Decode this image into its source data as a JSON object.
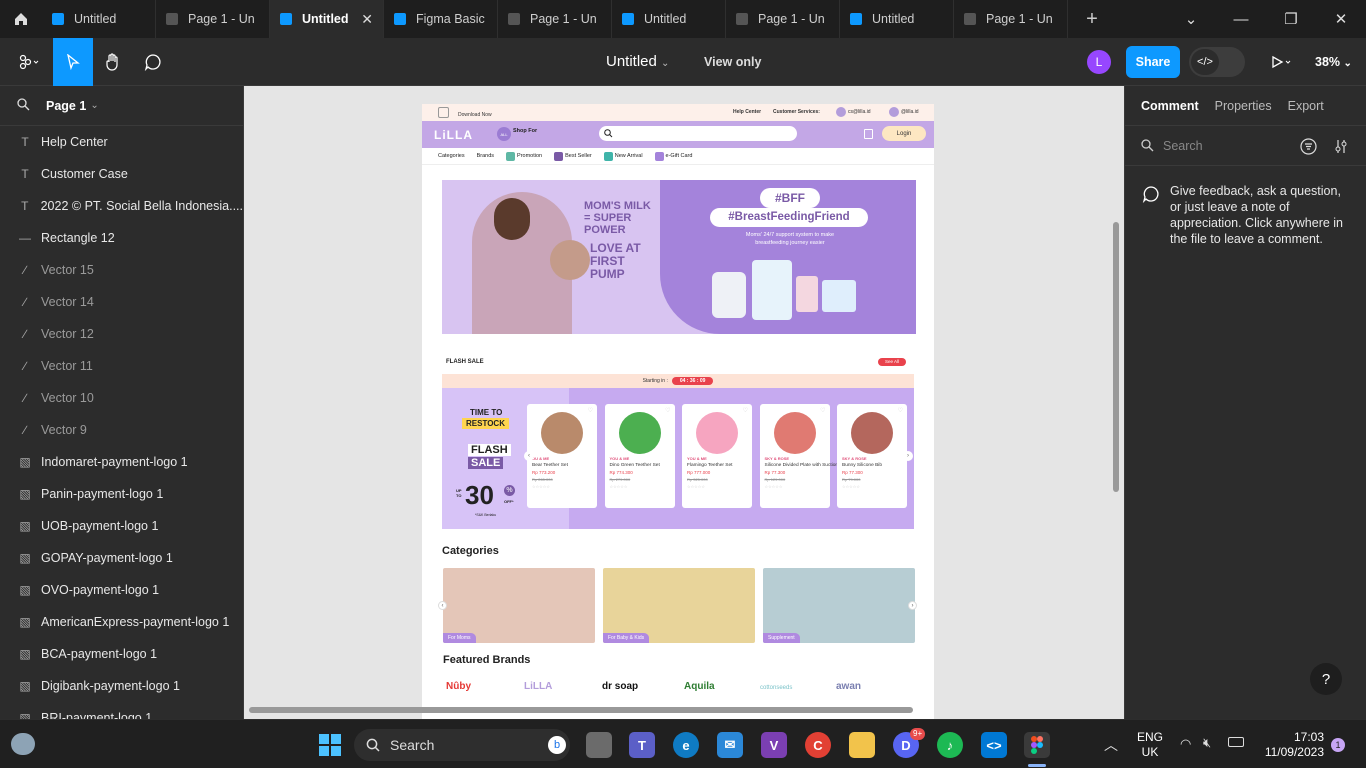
{
  "tabs": [
    {
      "label": "Untitled",
      "active": false
    },
    {
      "label": "Page 1 - Un",
      "active": false
    },
    {
      "label": "Untitled",
      "active": true
    },
    {
      "label": "Figma Basic",
      "active": false
    },
    {
      "label": "Page 1 - Un",
      "active": false
    },
    {
      "label": "Untitled",
      "active": false
    },
    {
      "label": "Page 1 - Un",
      "active": false
    },
    {
      "label": "Untitled",
      "active": false
    },
    {
      "label": "Page 1 - Un",
      "active": false
    }
  ],
  "toolbar": {
    "doc_title": "Untitled",
    "view_only": "View only",
    "avatar_initial": "L",
    "share": "Share",
    "zoom": "38%"
  },
  "left_panel": {
    "page": "Page 1",
    "layers": [
      {
        "label": "Help Center",
        "icon": "text-icon",
        "dim": false
      },
      {
        "label": "Customer Case",
        "icon": "text-icon",
        "dim": false
      },
      {
        "label": "2022 © PT. Social Bella Indonesia....",
        "icon": "text-icon",
        "dim": false
      },
      {
        "label": "Rectangle 12",
        "icon": "line-icon",
        "dim": false
      },
      {
        "label": "Vector 15",
        "icon": "vector-icon",
        "dim": true
      },
      {
        "label": "Vector 14",
        "icon": "vector-icon",
        "dim": true
      },
      {
        "label": "Vector 12",
        "icon": "vector-icon",
        "dim": true
      },
      {
        "label": "Vector 11",
        "icon": "vector-icon",
        "dim": true
      },
      {
        "label": "Vector 10",
        "icon": "vector-icon",
        "dim": true
      },
      {
        "label": "Vector 9",
        "icon": "vector-icon",
        "dim": true
      },
      {
        "label": "Indomaret-payment-logo 1",
        "icon": "image-icon",
        "dim": false
      },
      {
        "label": "Panin-payment-logo 1",
        "icon": "image-icon",
        "dim": false
      },
      {
        "label": "UOB-payment-logo 1",
        "icon": "image-icon",
        "dim": false
      },
      {
        "label": "GOPAY-payment-logo 1",
        "icon": "image-icon",
        "dim": false
      },
      {
        "label": "OVO-payment-logo 1",
        "icon": "image-icon",
        "dim": false
      },
      {
        "label": "AmericanExpress-payment-logo 1",
        "icon": "image-icon",
        "dim": false
      },
      {
        "label": "BCA-payment-logo 1",
        "icon": "image-icon",
        "dim": false
      },
      {
        "label": "Digibank-payment-logo 1",
        "icon": "image-icon",
        "dim": false
      },
      {
        "label": "BRI-payment-logo 1",
        "icon": "image-icon",
        "dim": false
      }
    ]
  },
  "right_panel": {
    "tabs": [
      "Comment",
      "Properties",
      "Export"
    ],
    "search_placeholder": "Search",
    "hint": "Give feedback, ask a question, or just leave a note of appreciation. Click anywhere in the file to leave a comment.",
    "help": "?"
  },
  "design": {
    "download": "Download Now",
    "help_center": "Help Center",
    "customer_services": "Customer Services:",
    "email1": "cs@lilla.id",
    "email2": "@lilla.id",
    "logo": "LiLLA",
    "shop_for": "Shop For",
    "login": "Login",
    "nav": [
      "Categories",
      "Brands",
      "Promotion",
      "Best Seller",
      "New Arrival",
      "e-Gift Card"
    ],
    "hero": {
      "tag": "#BFF",
      "title": "#BreastFeedingFriend",
      "subtitle": "Moms' 24/7 support system to make breastfeeding journey easier",
      "left_text1": "MOM'S MILK = SUPER POWER",
      "left_text2": "LOVE AT FIRST PUMP"
    },
    "flash": {
      "label": "FLASH SALE",
      "see_all": "See All",
      "starting": "Starting in :",
      "timer": "04 : 36 : 09",
      "restock1": "TIME TO",
      "restock2": "RESTOCK",
      "badge1": "FLASH",
      "badge2": "SALE",
      "up_to": "UP TO",
      "percent": "30",
      "off": "OFF*",
      "terms": "*S&K Berlaku"
    },
    "products": [
      {
        "tag": "OU & ME",
        "name": "Bear Teether Set",
        "price": "Rp 773.200",
        "old": "Rp 265.000",
        "color": "#b98a6b"
      },
      {
        "tag": "YOU & ME",
        "name": "Dino Green Teether Set",
        "price": "Rp 774.300",
        "old": "Rp 279.000",
        "color": "#4caf50"
      },
      {
        "tag": "YOU & ME",
        "name": "Flamingo Teether Set",
        "price": "Rp 777.000",
        "old": "Rp 325.000",
        "color": "#f6a5c0"
      },
      {
        "tag": "SKY & ROSE",
        "name": "Silicone Divided Plate with Suction",
        "price": "Rp 77.300",
        "old": "Rp 129.000",
        "color": "#e07a72"
      },
      {
        "tag": "SKY & ROSE",
        "name": "Bunny Silicone Bib",
        "price": "Rp 77.300",
        "old": "Rp 79.000",
        "color": "#b4675d"
      }
    ],
    "categories_title": "Categories",
    "categories": [
      {
        "label": "For Moms",
        "color": "#e4c6b8"
      },
      {
        "label": "For Baby & Kids",
        "color": "#e8d49a"
      },
      {
        "label": "Supplement",
        "color": "#b7cdd3"
      }
    ],
    "brands_title": "Featured Brands",
    "brands": [
      {
        "name": "Nûby",
        "color": "#e53935"
      },
      {
        "name": "LiLLA",
        "color": "#b39ddb"
      },
      {
        "name": "dr soap",
        "color": "#111111"
      },
      {
        "name": "Aquila",
        "color": "#2e7d32"
      },
      {
        "name": "cottonseeds",
        "color": "#7cc3c9"
      },
      {
        "name": "awan",
        "color": "#7a7fb0"
      }
    ]
  },
  "taskbar": {
    "search": "Search",
    "lang1": "ENG",
    "lang2": "UK",
    "time": "17:03",
    "date": "11/09/2023",
    "notif": "1",
    "discord_badge": "9+"
  }
}
